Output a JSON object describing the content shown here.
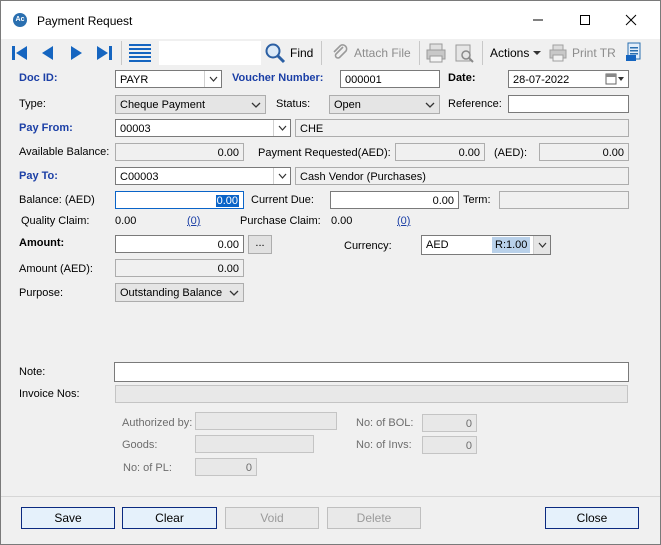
{
  "window": {
    "title": "Payment Request",
    "icon_text": "Ac"
  },
  "toolbar": {
    "find": "Find",
    "attach": "Attach File",
    "actions": "Actions",
    "print_tr": "Print TR"
  },
  "labels": {
    "doc_id": "Doc ID:",
    "voucher_number": "Voucher Number:",
    "date": "Date:",
    "type": "Type:",
    "status": "Status:",
    "reference": "Reference:",
    "pay_from": "Pay From:",
    "available_balance": "Available Balance:",
    "payment_requested": "Payment Requested(AED):",
    "aed": "(AED):",
    "pay_to": "Pay To:",
    "balance_aed": "Balance: (AED)",
    "current_due": "Current Due:",
    "term": "Term:",
    "quality_claim": "Quality Claim:",
    "purchase_claim": "Purchase Claim:",
    "amount": "Amount:",
    "currency": "Currency:",
    "amount_aed": "Amount (AED):",
    "purpose": "Purpose:",
    "note": "Note:",
    "invoice_nos": "Invoice Nos:",
    "authorized_by": "Authorized by:",
    "goods": "Goods:",
    "no_of_pl": "No: of PL:",
    "no_of_bol": "No: of BOL:",
    "no_of_invs": "No: of Invs:"
  },
  "fields": {
    "doc_id": "PAYR",
    "voucher_number": "000001",
    "date": "28-07-2022",
    "type": "Cheque Payment",
    "status": "Open",
    "reference": "",
    "pay_from_code": "00003",
    "pay_from_name": "CHE",
    "available_balance": "0.00",
    "payment_requested": "0.00",
    "aed_value": "0.00",
    "pay_to_code": "C00003",
    "pay_to_name": "Cash Vendor (Purchases)",
    "balance_aed": "0.00",
    "current_due": "0.00",
    "term": "",
    "quality_claim": "0.00",
    "quality_claim_link": "(0)",
    "purchase_claim": "0.00",
    "purchase_claim_link": "(0)",
    "amount": "0.00",
    "ellipsis": "...",
    "currency": "AED",
    "rate": "R:1.00",
    "amount_aed": "0.00",
    "purpose": "Outstanding Balance",
    "note": "",
    "invoice_nos": "",
    "authorized_by": "",
    "goods": "",
    "no_of_pl": "0",
    "no_of_bol": "0",
    "no_of_invs": "0"
  },
  "buttons": {
    "save": "Save",
    "clear": "Clear",
    "void": "Void",
    "delete": "Delete",
    "close": "Close"
  },
  "colors": {
    "label_blue": "#1b3fa6",
    "nav_blue": "#1565c0"
  }
}
